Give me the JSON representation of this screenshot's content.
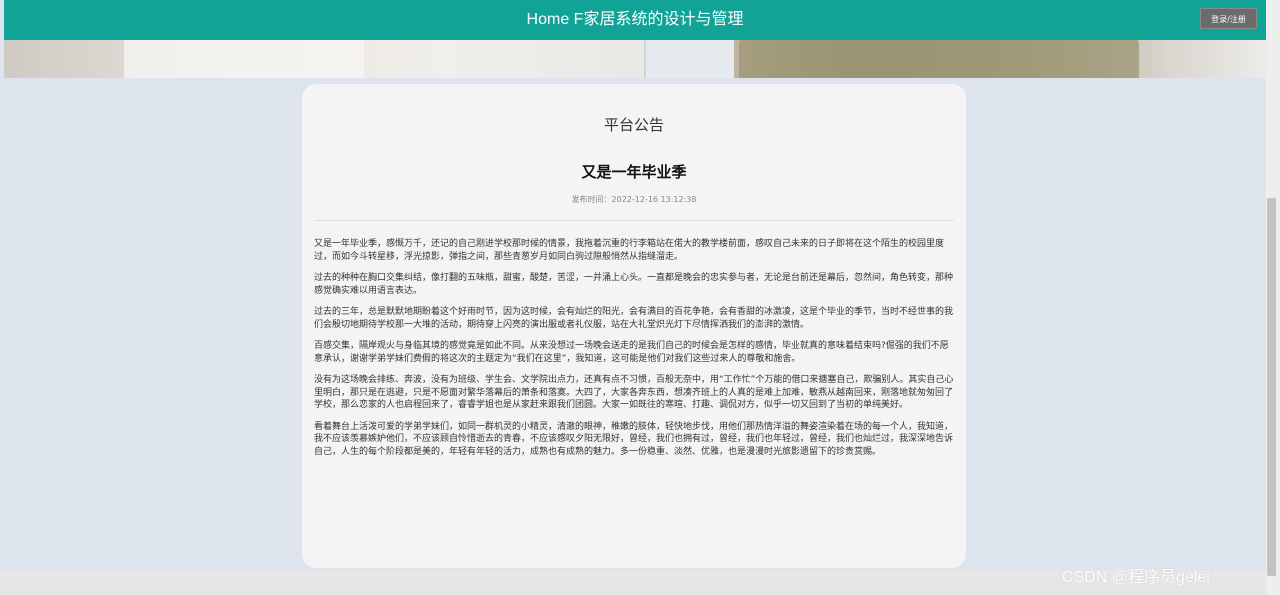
{
  "header": {
    "title": "Home F家居系统的设计与管理",
    "login_label": "登录/注册"
  },
  "notice": {
    "section_title": "平台公告",
    "article_title": "又是一年毕业季",
    "publish_time": "发布时间：2022-12-16 13:12:38",
    "paragraphs": [
      "又是一年毕业季，感慨万千，还记的自己刚进学校那时候的情景，我拖着沉重的行李箱站在偌大的教学楼前面，感叹自己未来的日子即将在这个陌生的校园里度过，而如今斗转星移，浮光掠影，弹指之间，那些青葱岁月如同白驹过隙般悄然从指缝溜走。",
      "过去的种种在胸口交集纠结，像打翻的五味瓶，甜蜜，酸楚，苦涩，一并涌上心头。一直都是晚会的忠实参与者，无论是台前还是幕后，忽然间，角色转变，那种感觉确实难以用语言表达。",
      "过去的三年，总是默默地期盼着这个好雨时节，因为这时候，会有灿烂的阳光，会有满目的百花争艳，会有香甜的冰激凌，这是个毕业的季节，当时不经世事的我们会殷切地期待学校那一大堆的活动，期待穿上闪亮的演出服或者礼仪服，站在大礼堂炽光灯下尽情挥洒我们的澎湃的激情。",
      "百感交集，隔岸观火与身临其境的感觉竟是如此不同。从来没想过一场晚会送走的是我们自己的时候会是怎样的感情，毕业就真的意味着结束吗?倔强的我们不愿意承认，谢谢学弟学妹们费假的将这次的主题定为“我们在这里”，我知道，这可能是他们对我们这些过来人的尊敬和施舍。",
      "没有为这场晚会排练、奔波，没有为班级、学生会、文学院出点力，还真有点不习惯，百般无奈中，用“工作忙”个万能的借口来搪塞自己，欺骗别人。其实自己心里明白，那只是在逃避，只是不愿面对繁华落幕后的萧条和落寞。大四了，大家各奔东西，想凑齐班上的人真的是难上加难，敏燕从越南回来，刚落地就匆匆回了学校，那么恋家的人也启程回来了，睿睿学姐也是从家赶来跟我们团圆。大家一如既往的寒暄、打趣、调侃对方，似乎一切又回到了当初的单纯美好。",
      "看着舞台上活泼可爱的学弟学妹们，如同一群机灵的小精灵，清澈的眼神，稚嫩的肢体，轻快地步伐，用他们那热情洋溢的舞姿渲染着在场的每一个人，我知道，我不应该羡慕嫉妒他们，不应该顾自怜惜逝去的青春，不应该感叹夕阳无限好，曾经，我们也拥有过，曾经，我们也年轻过，曾经，我们也灿烂过，我深深地告诉自己，人生的每个阶段都是美的，年轻有年轻的活力，成熟也有成熟的魅力。多一份稳重、淡然、优雅，也是漫漫时光旅影遗留下的珍贵赏赐。"
    ]
  },
  "watermark": "CSDN @程序员gelei",
  "colors": {
    "header_bg": "#12a397",
    "page_bg": "#dde4ee",
    "card_bg": "#f4f4f4"
  }
}
